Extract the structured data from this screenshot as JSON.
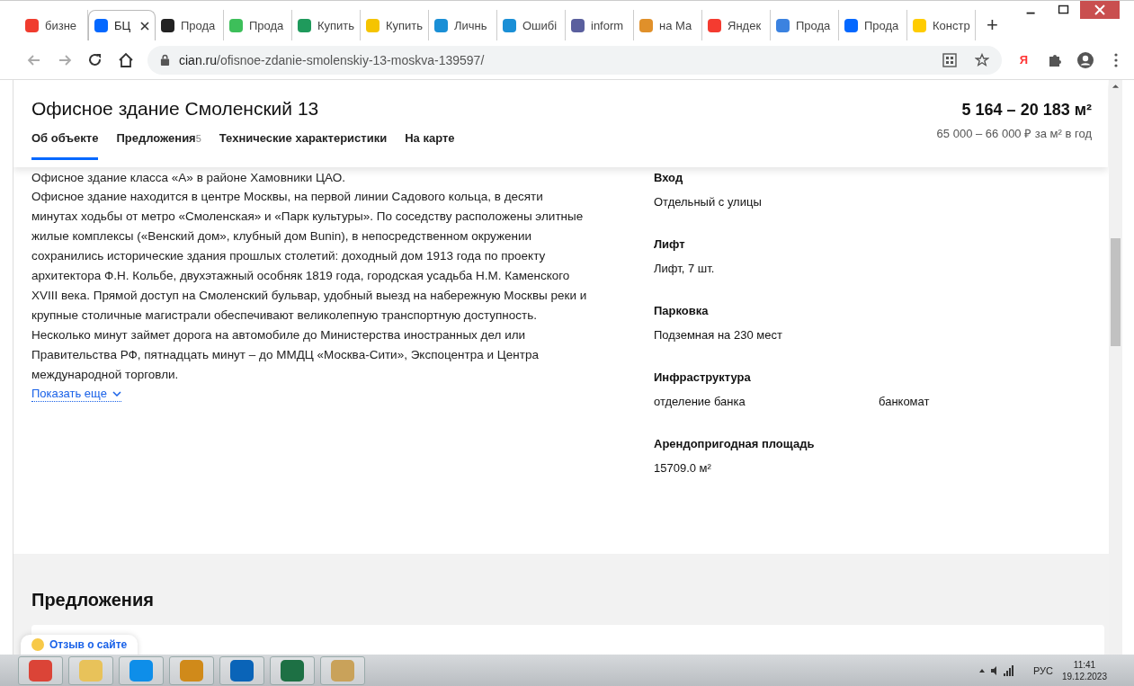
{
  "browser": {
    "tabs": [
      {
        "title": "бизне",
        "selected": false,
        "color": "#f03c2e"
      },
      {
        "title": "БЦ",
        "selected": true,
        "color": "#0468ff"
      },
      {
        "title": "Прода",
        "selected": false,
        "color": "#222222"
      },
      {
        "title": "Прода",
        "selected": false,
        "color": "#3dbf5a"
      },
      {
        "title": "Купить",
        "selected": false,
        "color": "#1f9a5c"
      },
      {
        "title": "Купить",
        "selected": false,
        "color": "#f5c400"
      },
      {
        "title": "Личнь",
        "selected": false,
        "color": "#1a8fd6"
      },
      {
        "title": "Ошибі",
        "selected": false,
        "color": "#1a8fd6"
      },
      {
        "title": "inform",
        "selected": false,
        "color": "#5a5f9e"
      },
      {
        "title": "на Ма",
        "selected": false,
        "color": "#e0902a"
      },
      {
        "title": "Яндек",
        "selected": false,
        "color": "#f43b30"
      },
      {
        "title": "Прода",
        "selected": false,
        "color": "#3b82e0"
      },
      {
        "title": "Прода",
        "selected": false,
        "color": "#0468ff"
      },
      {
        "title": "Констр",
        "selected": false,
        "color": "#ffcc00"
      }
    ],
    "new_tab": "+",
    "url_host": "cian.ru",
    "url_path": "/ofisnoe-zdanie-smolenskiy-13-moskva-139597/",
    "ya": "Я"
  },
  "header": {
    "title": "Офисное здание Смоленский 13",
    "area": "5 164 – 20 183 м²",
    "price": "65 000 – 66 000 ₽ за м² в год",
    "nav": [
      {
        "label": "Об объекте",
        "selected": true
      },
      {
        "label": "Предложения",
        "count": "5",
        "selected": false
      },
      {
        "label": "Технические характеристики",
        "selected": false
      },
      {
        "label": "На карте",
        "selected": false
      }
    ]
  },
  "description": {
    "first_line": "Офисное здание класса «А» в районе Хамовники ЦАО.",
    "text": "Офисное здание находится в центре Москвы, на первой линии Садового кольца, в десяти минутах ходьбы от метро «Смоленская» и «Парк культуры». По соседству расположены элитные жилые комплексы («Венский дом», клубный дом Bunin), в непосредственном окружении сохранились исторические здания прошлых столетий: доходный дом 1913 года по проекту архитектора Ф.Н. Кольбе, двухэтажный особняк 1819 года, городская усадьба Н.М. Каменского XVIII века. Прямой доступ на Смоленский бульвар, удобный выезд на набережную Москвы реки и крупные столичные магистрали обеспечивают великолепную транспортную доступность. Несколько минут займет дорога на автомобиле до Министерства иностранных дел или Правительства РФ, пятнадцать минут – до ММДЦ «Москва-Сити», Экспоцентра и Центра международной торговли.",
    "more": "Показать еще"
  },
  "specs": [
    {
      "label": "Вход",
      "values": [
        "Отдельный с улицы"
      ]
    },
    {
      "label": "Лифт",
      "values": [
        "Лифт, 7 шт."
      ]
    },
    {
      "label": "Парковка",
      "values": [
        "Подземная на 230 мест"
      ]
    },
    {
      "label": "Инфраструктура",
      "values": [
        "отделение банка",
        "банкомат"
      ]
    },
    {
      "label": "Арендопригодная площадь",
      "values": [
        "15709.0 м²"
      ]
    }
  ],
  "offers": {
    "title": "Предложения"
  },
  "feedback": "Отзыв о сайте",
  "taskbar": {
    "apps": [
      {
        "color": "#db4437"
      },
      {
        "color": "#e8c25a"
      },
      {
        "color": "#0e8ee9"
      },
      {
        "color": "#d08a1a"
      },
      {
        "color": "#0a64b8"
      },
      {
        "color": "#1d7044"
      },
      {
        "color": "#c9a25a"
      }
    ],
    "lang": "РУС",
    "time": "11:41",
    "date": "19.12.2023"
  }
}
